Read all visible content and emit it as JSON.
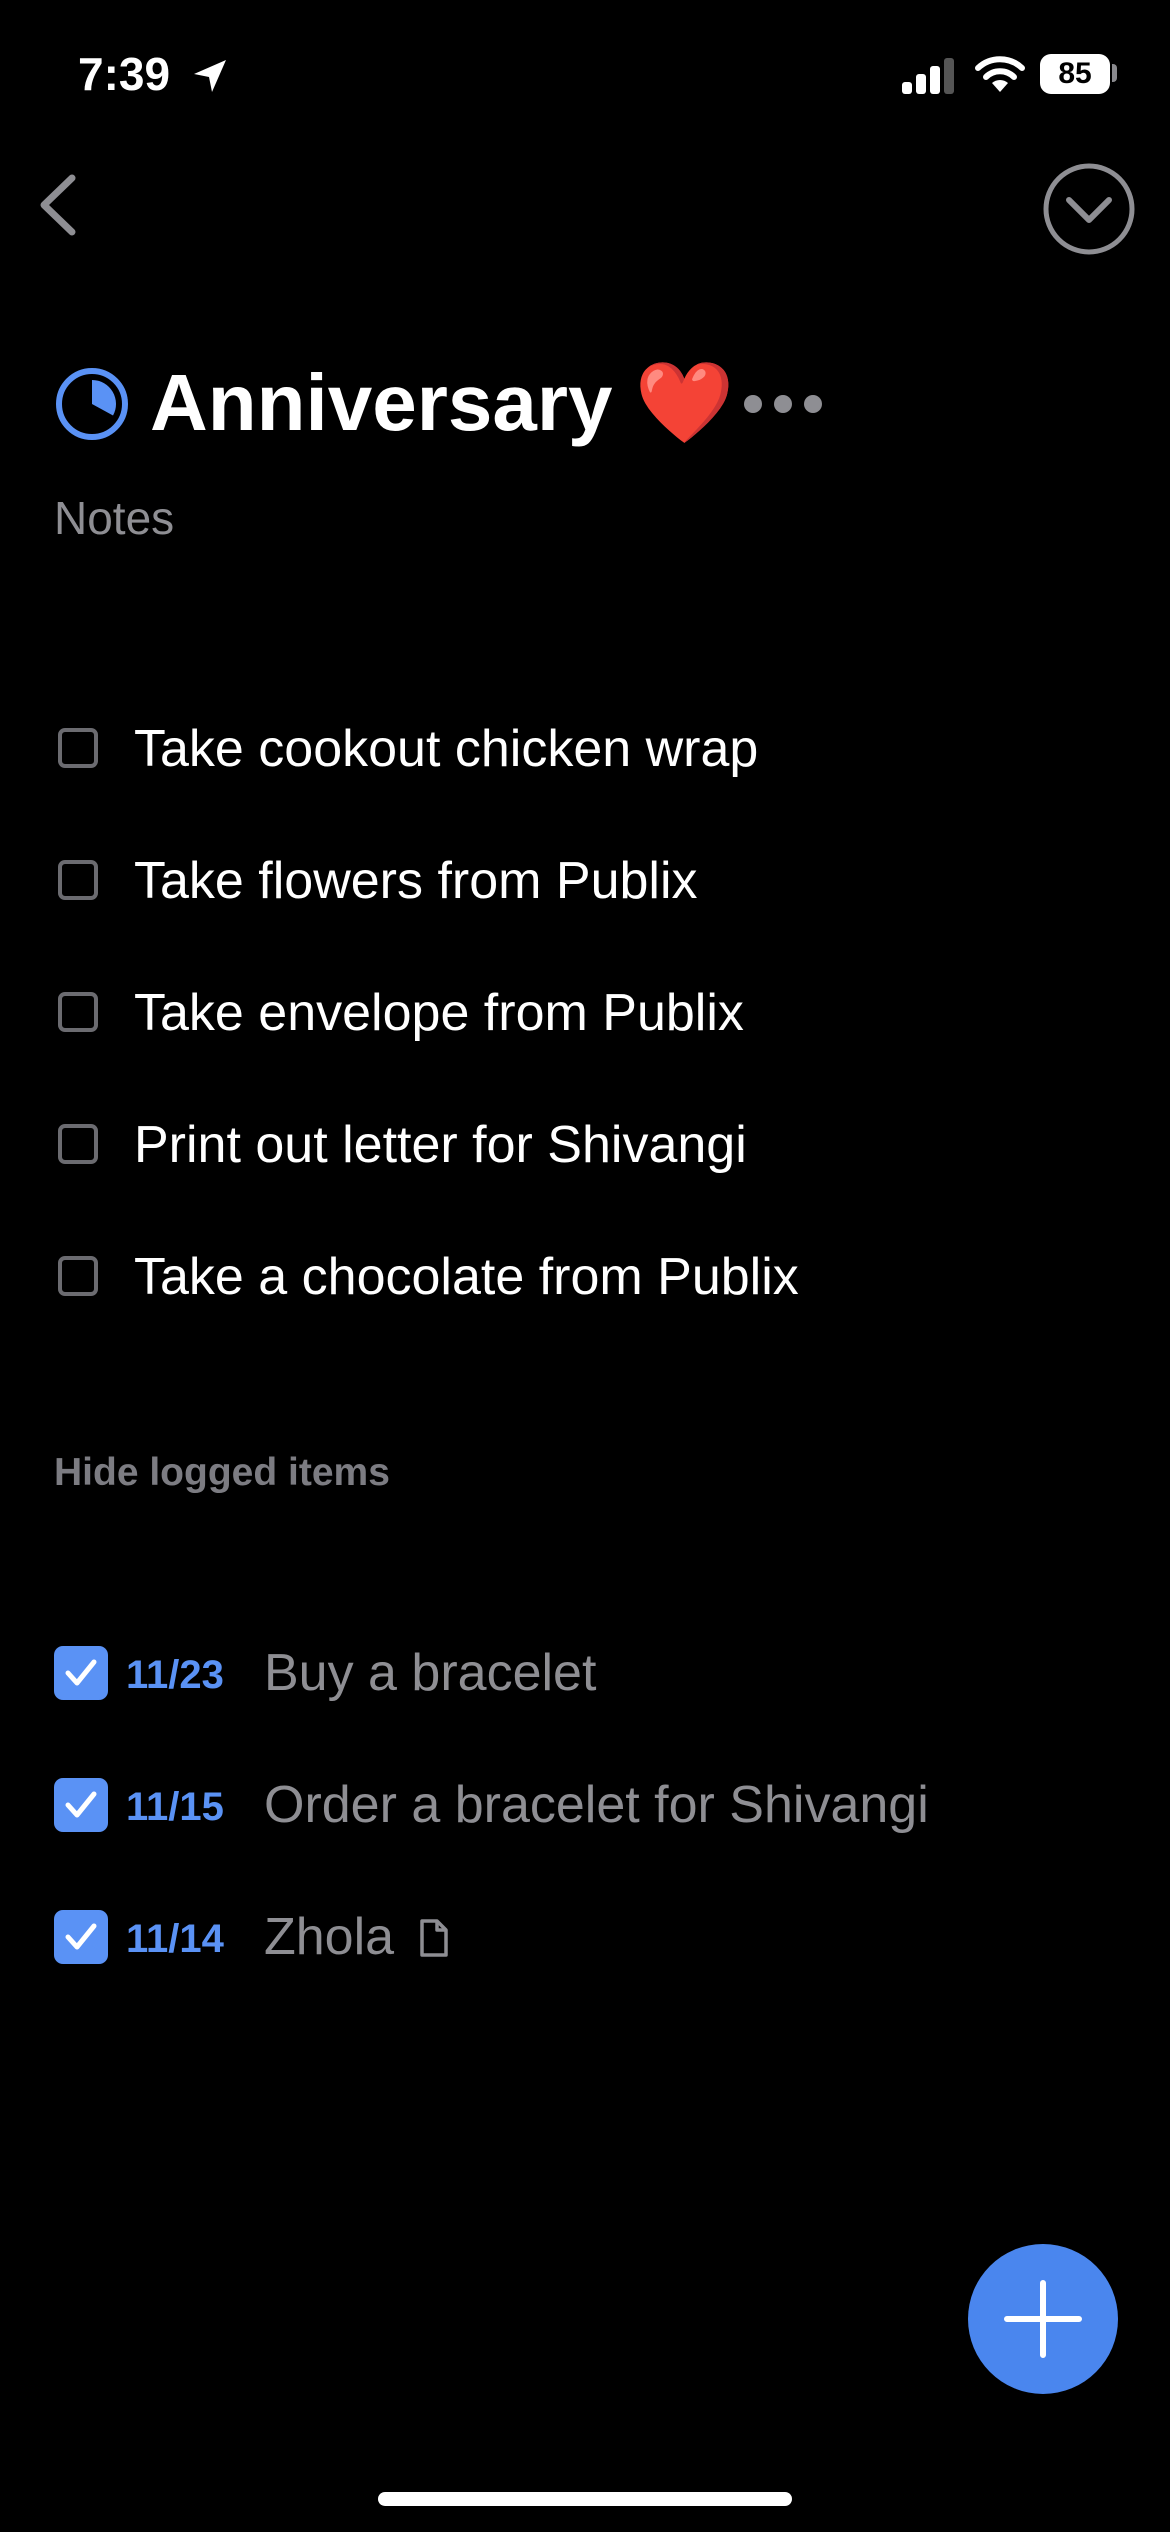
{
  "status_bar": {
    "time": "7:39",
    "battery": "85",
    "icons": [
      "location-arrow-icon",
      "cellular-signal-icon",
      "wifi-icon",
      "battery-icon"
    ]
  },
  "nav": {
    "back_icon": "chevron-left-icon",
    "done_icon": "chevron-down-circle-icon"
  },
  "project": {
    "title": "Anniversary ❤️",
    "progress_icon": "pie-progress-icon",
    "progress_fraction": 0.33,
    "more_icon": "ellipsis-icon",
    "notes_placeholder": "Notes"
  },
  "todos": [
    {
      "label": "Take cookout chicken wrap",
      "checked": false
    },
    {
      "label": "Take flowers from Publix",
      "checked": false
    },
    {
      "label": "Take envelope from Publix",
      "checked": false
    },
    {
      "label": "Print out letter for Shivangi",
      "checked": false
    },
    {
      "label": "Take a chocolate from Publix",
      "checked": false
    }
  ],
  "logged_toggle": "Hide logged items",
  "logged": [
    {
      "date": "11/23",
      "label": "Buy a bracelet",
      "checked": true
    },
    {
      "date": "11/15",
      "label": "Order a bracelet for Shivangi",
      "checked": true
    },
    {
      "date": "11/14",
      "label": "Zhola",
      "checked": true,
      "has_note_icon": true
    }
  ],
  "fab": {
    "icon": "plus-icon"
  },
  "colors": {
    "background": "#000000",
    "accent": "#5a92f5",
    "fab": "#4a86ee",
    "secondary_text": "#8e8e93"
  }
}
